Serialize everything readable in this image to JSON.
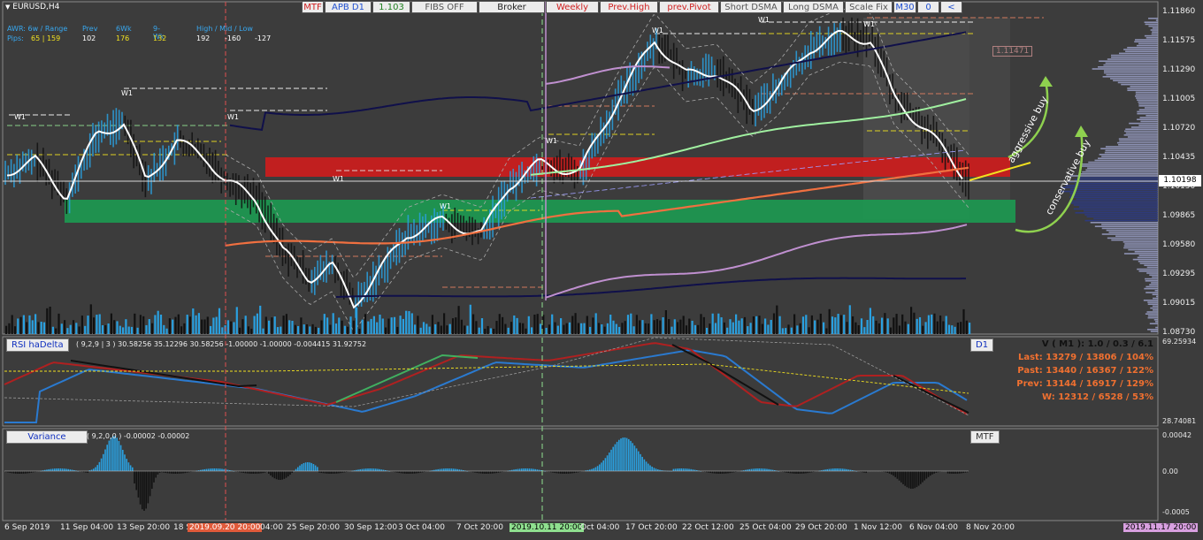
{
  "window": {
    "symbol": "EURUSD,H4"
  },
  "toolbar": [
    {
      "label": "MTF",
      "color": "#d02020"
    },
    {
      "label": "APB D1",
      "color": "#2050d0"
    },
    {
      "label": "1.103",
      "color": "#208020"
    },
    {
      "label": "FIBS OFF",
      "color": "#555555"
    },
    {
      "label": "Broker",
      "color": "#222222"
    },
    {
      "label": "Weekly",
      "color": "#d02020"
    },
    {
      "label": "Prev.High",
      "color": "#d02020"
    },
    {
      "label": "prev.Pivot",
      "color": "#d02020"
    },
    {
      "label": "Short DSMA",
      "color": "#555555"
    },
    {
      "label": "Long DSMA",
      "color": "#555555"
    },
    {
      "label": "Scale Fix",
      "color": "#555555"
    },
    {
      "label": "M30",
      "color": "#2050d0"
    },
    {
      "label": "0",
      "color": "#2050d0"
    },
    {
      "label": "<",
      "color": "#2050d0"
    }
  ],
  "awr": {
    "row1": [
      "AWR: 6w / Range",
      "Prev",
      "6Wk",
      "9-Wk",
      "High / Mid / Low"
    ],
    "row2_label": "Pips:",
    "row2": [
      "65 | 159",
      "102",
      "176",
      "132",
      "192",
      "-160",
      "-127"
    ]
  },
  "price_axis": [
    "1.11860",
    "1.11575",
    "1.11290",
    "1.11005",
    "1.10720",
    "1.10435",
    "1.10150",
    "1.09865",
    "1.09580",
    "1.09295",
    "1.09015",
    "1.08730"
  ],
  "current_price": "1.10198",
  "marker_price": "1.11471",
  "annotations": {
    "aggressive": "aggressive buy",
    "conservative": "conservative buy"
  },
  "week_labels": [
    "W1",
    "W1",
    "W1",
    "W1",
    "W1",
    "W1",
    "W1",
    "W1"
  ],
  "time_axis": [
    "6 Sep 2019",
    "11 Sep 04:00",
    "13 Sep 20:00",
    "18 S",
    "2019.09.20 20:00",
    "04:00",
    "25 Sep 20:00",
    "30 Sep 12:00",
    "3 Oct 04:00",
    "7 Oct 20:00",
    "2019.10.11 20:00",
    "Oct 04:00",
    "17 Oct 20:00",
    "22 Oct 12:00",
    "25 Oct 04:00",
    "29 Oct 20:00",
    "1 Nov 12:00",
    "6 Nov 04:00",
    "8 Nov 20:00",
    "2019.11.17 20:00"
  ],
  "rsi": {
    "label": "RSI haDelta",
    "params": "( 9,2,9 | 3 ) 30.58256 35.12296 30.58256 -1.00000 -1.00000 -0.004415 31.92752",
    "tf_badge": "D1",
    "axis_top": "69.25934",
    "axis_bottom": "28.74081",
    "stats": [
      {
        "text": "V ( M1 ): 1.0 / 0.3 / 6.1",
        "color": "#111111"
      },
      {
        "text": "Last: 13279 / 13806 / 104%",
        "color": "#f07030"
      },
      {
        "text": "Past: 13440 / 16367 / 122%",
        "color": "#f07030"
      },
      {
        "text": "Prev: 13144 / 16917 / 129%",
        "color": "#f07030"
      },
      {
        "text": "W: 12312 / 6528 / 53%",
        "color": "#f07030"
      }
    ]
  },
  "variance": {
    "label": "Variance",
    "params": "( 9,2,0,0 ) -0.00002 -0.00002",
    "tf_badge": "MTF",
    "axis": [
      "0.00042",
      "0.00",
      "-0.0005"
    ]
  },
  "colors": {
    "bg": "#3c3c3c",
    "bull": "#2aa0e0",
    "bear": "#111111",
    "red_zone": "#c81e1e",
    "green_zone": "#1e9650"
  }
}
